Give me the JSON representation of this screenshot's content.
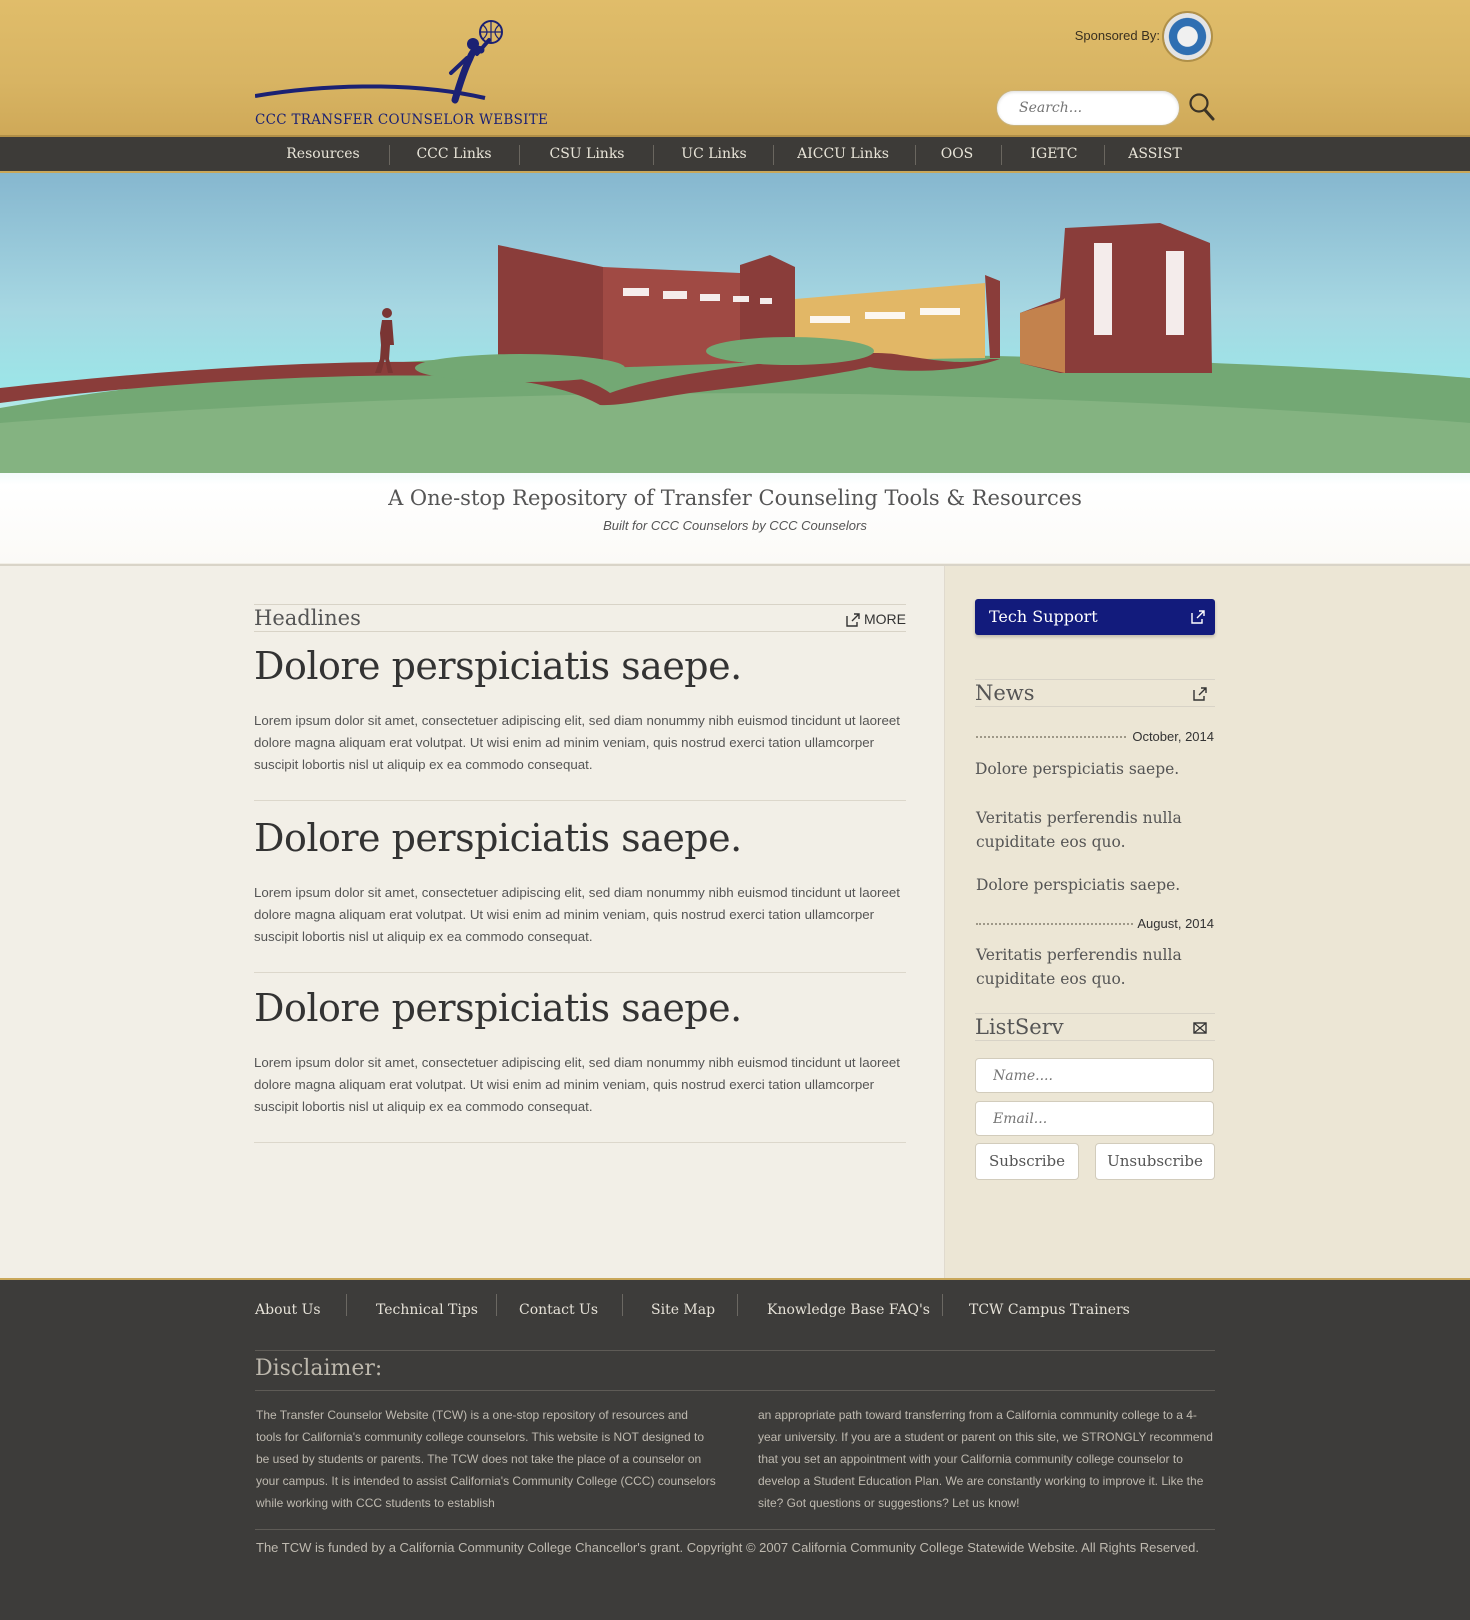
{
  "header": {
    "logo_text": "CCC TRANSFER COUNSELOR WEBSITE",
    "sponsor_label": "Sponsored By:",
    "search_placeholder": "Search..."
  },
  "nav": {
    "items": [
      "Resources",
      "CCC Links",
      "CSU Links",
      "UC Links",
      "AICCU Links",
      "OOS",
      "IGETC",
      "ASSIST"
    ]
  },
  "hero": {
    "tagline": "A One-stop Repository of Transfer Counseling Tools & Resources",
    "subtagline": "Built for CCC Counselors by CCC Counselors"
  },
  "headlines": {
    "title": "Headlines",
    "more_label": "MORE",
    "articles": [
      {
        "title": "Dolore perspiciatis saepe.",
        "body": "Lorem ipsum dolor sit amet, consectetuer adipiscing elit, sed diam nonummy nibh euismod tincidunt ut laoreet dolore magna aliquam erat volutpat. Ut wisi enim ad minim veniam, quis nostrud exerci tation ullamcorper suscipit lobortis nisl ut aliquip ex ea commodo consequat."
      },
      {
        "title": "Dolore perspiciatis saepe.",
        "body": "Lorem ipsum dolor sit amet, consectetuer adipiscing elit, sed diam nonummy nibh euismod tincidunt ut laoreet dolore magna aliquam erat volutpat. Ut wisi enim ad minim veniam, quis nostrud exerci tation ullamcorper suscipit lobortis nisl ut aliquip ex ea commodo consequat."
      },
      {
        "title": "Dolore perspiciatis saepe.",
        "body": "Lorem ipsum dolor sit amet, consectetuer adipiscing elit, sed diam nonummy nibh euismod tincidunt ut laoreet dolore magna aliquam erat volutpat. Ut wisi enim ad minim veniam, quis nostrud exerci tation ullamcorper suscipit lobortis nisl ut aliquip ex ea commodo consequat."
      }
    ]
  },
  "sidebar": {
    "tech_support_label": "Tech Support",
    "news_title": "News",
    "news": [
      {
        "date": "October, 2014",
        "items": [
          "Dolore perspiciatis saepe.",
          "Veritatis perferendis nulla cupiditate eos quo.",
          "Dolore perspiciatis saepe."
        ]
      },
      {
        "date": "August, 2014",
        "items": [
          "Veritatis perferendis nulla cupiditate eos quo."
        ]
      }
    ],
    "listserv_title": "ListServ",
    "name_placeholder": "Name....",
    "email_placeholder": "Email...",
    "subscribe_label": "Subscribe",
    "unsubscribe_label": "Unsubscribe"
  },
  "footer": {
    "links": [
      "About Us",
      "Technical Tips",
      "Contact Us",
      "Site Map",
      "Knowledge Base FAQ's",
      "TCW Campus Trainers"
    ],
    "disclaimer_title": "Disclaimer:",
    "disclaimer_left": "The Transfer Counselor Website (TCW) is a one-stop repository of resources and tools for California's community college counselors. This website is NOT designed to be used by students or parents. The TCW does not take the place of a counselor on your campus. It is intended to assist California's Community College (CCC) counselors while working with CCC students to establish",
    "disclaimer_right": "an appropriate path toward transferring from a California community college to a 4-year university. If you are a student or parent on this site, we STRONGLY recommend that you set an appointment with your California community college counselor to develop a Student Education Plan.  We are constantly working to improve it. Like the site? Got questions or suggestions? Let us know!",
    "copyright": "The TCW is funded by a California Community College Chancellor's grant.  Copyright © 2007 California Community College Statewide Website. All Rights Reserved."
  },
  "colors": {
    "header_gold": "#d8b463",
    "nav_dark": "#3d3b38",
    "brand_navy": "#121b7c",
    "footer_dark": "#3d3c3a"
  }
}
